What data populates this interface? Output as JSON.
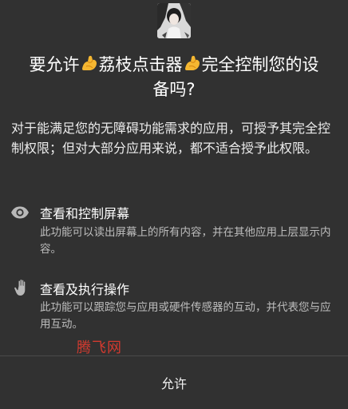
{
  "dialog": {
    "title_prefix": "要允许",
    "app_name": "荔枝点击器",
    "title_suffix_line1": "完全控制您的设",
    "title_suffix_line2": "备吗?",
    "description": "对于能满足您的无障碍功能需求的应用，可授予其完全控制权限；但对大部分应用来说，都不适合授予此权限。",
    "permissions": [
      {
        "icon": "eye-icon",
        "title": "查看和控制屏幕",
        "description": "此功能可以读出屏幕上的所有内容，并在其他应用上层显示内容。"
      },
      {
        "icon": "hand-icon",
        "title": "查看及执行操作",
        "description": "此功能可以跟踪您与应用或硬件传感器的互动，并代表您与应用互动。"
      }
    ],
    "allow_label": "允许"
  },
  "watermark": "腾飞网",
  "colors": {
    "background": "#313131",
    "primary_text": "#ffffff",
    "secondary_text": "#bdbdbd",
    "watermark": "#d33a2f"
  }
}
